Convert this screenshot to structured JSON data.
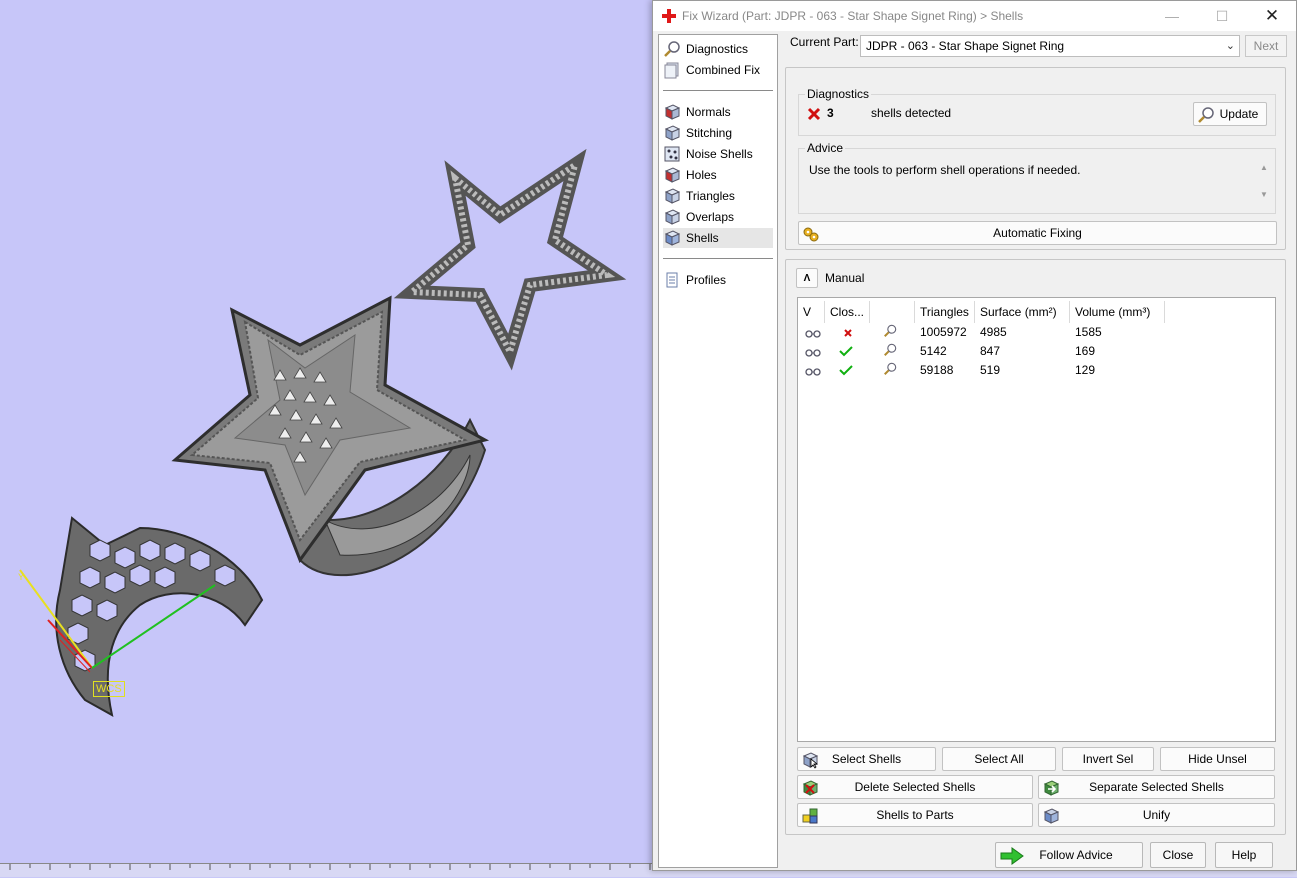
{
  "dialog": {
    "title": "Fix Wizard (Part: JDPR - 063 - Star Shape Signet Ring) > Shells"
  },
  "nav": {
    "items": [
      {
        "label": "Diagnostics",
        "icon": "magnifier-icon"
      },
      {
        "label": "Combined Fix",
        "icon": "combined-fix-icon"
      },
      {
        "label": "Normals",
        "icon": "normals-cube-icon"
      },
      {
        "label": "Stitching",
        "icon": "stitching-cube-icon"
      },
      {
        "label": "Noise Shells",
        "icon": "noise-shells-icon"
      },
      {
        "label": "Holes",
        "icon": "holes-cube-icon"
      },
      {
        "label": "Triangles",
        "icon": "triangles-cube-icon"
      },
      {
        "label": "Overlaps",
        "icon": "overlaps-cube-icon"
      },
      {
        "label": "Shells",
        "icon": "shells-cube-icon"
      },
      {
        "label": "Profiles",
        "icon": "profiles-document-icon"
      }
    ],
    "active": "Shells"
  },
  "current_part": {
    "label": "Current Part:",
    "value": "JDPR - 063 - Star Shape Signet Ring",
    "next_label": "Next"
  },
  "diagnostics": {
    "title": "Diagnostics",
    "count": "3",
    "message": "shells detected",
    "update_label": "Update"
  },
  "advice": {
    "title": "Advice",
    "text": "Use the tools to perform shell operations if needed."
  },
  "automatic_fixing_label": "Automatic Fixing",
  "manual": {
    "label": "Manual",
    "columns": [
      "V",
      "Clos...",
      "",
      "Triangles",
      "Surface (mm²)",
      "Volume (mm³)"
    ],
    "rows": [
      {
        "closed": false,
        "triangles": "1005972",
        "surface": "4985",
        "volume": "1585"
      },
      {
        "closed": true,
        "triangles": "5142",
        "surface": "847",
        "volume": "169"
      },
      {
        "closed": true,
        "triangles": "59188",
        "surface": "519",
        "volume": "129"
      }
    ]
  },
  "actions": {
    "select_shells": "Select Shells",
    "select_all": "Select All",
    "invert_sel": "Invert Sel",
    "hide_unsel": "Hide Unsel",
    "delete_selected": "Delete Selected Shells",
    "separate_selected": "Separate Selected Shells",
    "shells_to_parts": "Shells to Parts",
    "unify": "Unify"
  },
  "footer": {
    "follow_advice": "Follow Advice",
    "close": "Close",
    "help": "Help"
  },
  "viewport": {
    "wcs_label": "WCS",
    "axis_label": "Y"
  },
  "colors": {
    "viewport_bg": "#c7c6f9",
    "error_red": "#d01010",
    "check_green": "#10b010"
  }
}
